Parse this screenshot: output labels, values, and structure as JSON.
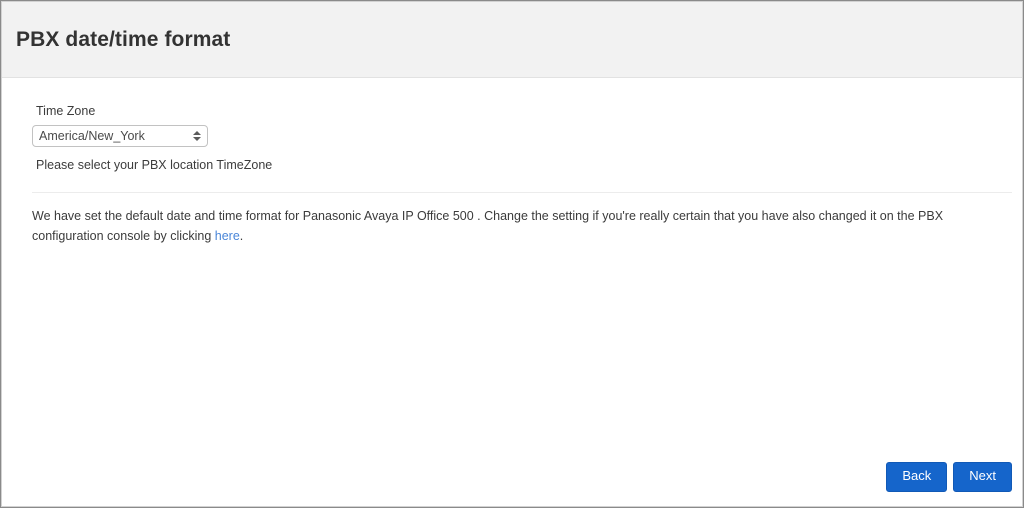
{
  "window": {
    "title": "PBX date/time format"
  },
  "header": {
    "title": "PBX date/time format"
  },
  "form": {
    "timezone": {
      "label": "Time Zone",
      "value": "America/New_York",
      "options": [
        "America/New_York"
      ],
      "help": "Please select your PBX location TimeZone",
      "arrow_icon": "updown-chevron-icon"
    }
  },
  "notice": {
    "text_before_link": "We have set the default date and time format for Panasonic Avaya IP Office 500 . Change the setting if you're really certain that you have also changed it on the PBX configuration console by clicking ",
    "link_label": "here",
    "text_after_link": "."
  },
  "footer": {
    "back_label": "Back",
    "next_label": "Next"
  },
  "colors": {
    "header_background": "#f2f2f2",
    "title_text": "#333333",
    "button_blue": "#1565cb",
    "link_blue": "#4a86d8",
    "body_text": "#3b3b3b",
    "divider": "#ececec",
    "frame_outer": "#8a8a8a",
    "frame_inner": "#d2d2d2"
  }
}
